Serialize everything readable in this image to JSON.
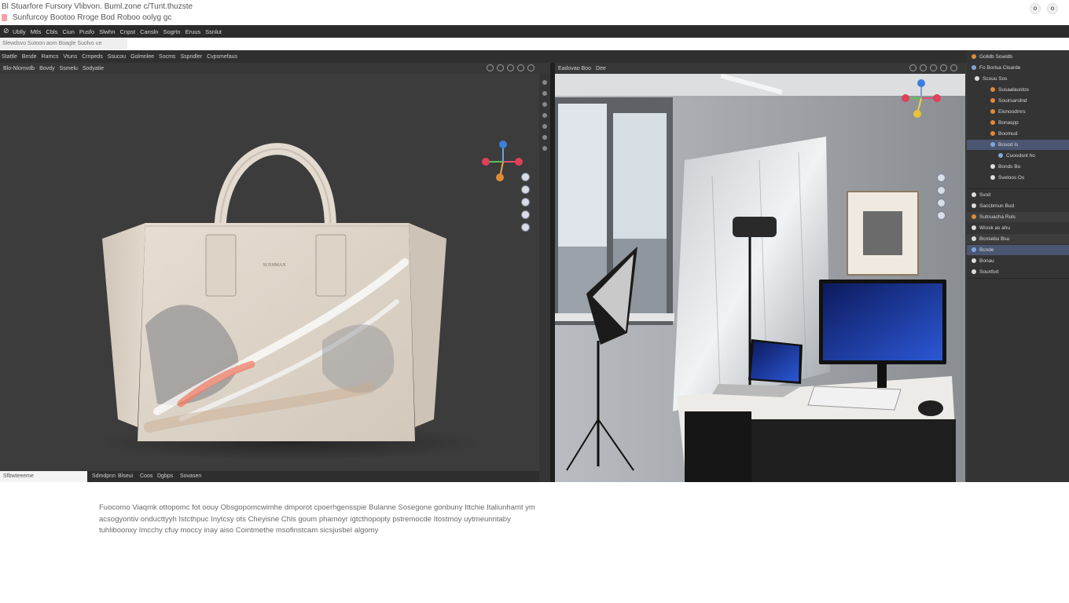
{
  "window": {
    "title_line": "Bl Stuarfore Fursory Vlibvon. Buml.zone c/Tunt.thuzste",
    "tab_line": "Sunfurcoy Bootoo Rroge Bod Roboo oolyg gc",
    "controls": [
      "minimize-icon",
      "close-icon"
    ]
  },
  "menubar": {
    "items": [
      "Ublly",
      "Mtls",
      "Cbls",
      "Ciun",
      "Pusfo",
      "Slwhn",
      "Cnpst",
      "Cansln",
      "Sogrtn",
      "Eruus",
      "Ssnlut"
    ]
  },
  "tab": {
    "label": "Slewdsvo Sutoon aom Boagle Suolvo ue"
  },
  "toolbar": {
    "items": [
      "Stattle",
      "Brnde",
      "Ramcs",
      "Vtuns",
      "Crnpeds",
      "Ssucou",
      "Golmnlee",
      "Socms",
      "Sspndler",
      "Cvpsmefaus"
    ]
  },
  "viewport_left": {
    "header": [
      "Blo-Nlomvdb",
      "Bovdy",
      "Ssmelu",
      "Sodyatie"
    ],
    "status_field": "Sfbwteeeme",
    "status_items": [
      "Sdmdpnn",
      "Blseui",
      "Coos",
      "Dgbps",
      "Sovasen"
    ],
    "object_brand": "SUSHMAN"
  },
  "viewport_right": {
    "header": [
      "Eadovao Boo",
      "Dee"
    ]
  },
  "outliner": {
    "rows": [
      {
        "label": "Golldb Sowldb",
        "color": "#e08a3a"
      },
      {
        "label": "Fo Borlsa Cloarde",
        "color": "#7fa8d8"
      },
      {
        "label": "Scouu Sos",
        "color": "#dddddd"
      },
      {
        "label": "Susaalaustos",
        "color": "#e08a3a"
      },
      {
        "label": "Souirsarolnd",
        "color": "#e08a3a"
      },
      {
        "label": "Elonoodmrs",
        "color": "#e08a3a"
      },
      {
        "label": "Bonaspp",
        "color": "#e08a3a"
      },
      {
        "label": "Boomud",
        "color": "#e08a3a"
      },
      {
        "label": "Bosod Is",
        "color": "#7fa8d8"
      },
      {
        "label": "Cuoodsnt ho",
        "color": "#7fa8d8"
      },
      {
        "label": "Bonds Bo",
        "color": "#dddddd"
      },
      {
        "label": "Sveloos Os",
        "color": "#dddddd"
      }
    ],
    "props": [
      {
        "label": "Svoil"
      },
      {
        "label": "Saccbmun Bud"
      },
      {
        "label": "Sutnuacha Ruls"
      },
      {
        "label": "Wiosk as ahu"
      },
      {
        "label": "Bcnsebu Bsu"
      },
      {
        "label": "Bcnde"
      },
      {
        "label": "Bonau"
      },
      {
        "label": "Sounfort"
      }
    ]
  },
  "description": "Fuocomo Viaqmk ottopomc fot oouy Obsgopomcwimhe dmporot cpoerhgensspie Bulanne Sosegone gonbuny Ittchie Italiunhamt ym acsogyontiv onducttyyh Istcthpuc Inytcsy ots Cheyisne Chls goum phamoyr igtcthopopty pstremocde Itostmoy uytmeunntaby tuhliboonxy Imcchy cfuy moccy inay aiso Cointmethe msofinstcam sicsjusbel algomy"
}
